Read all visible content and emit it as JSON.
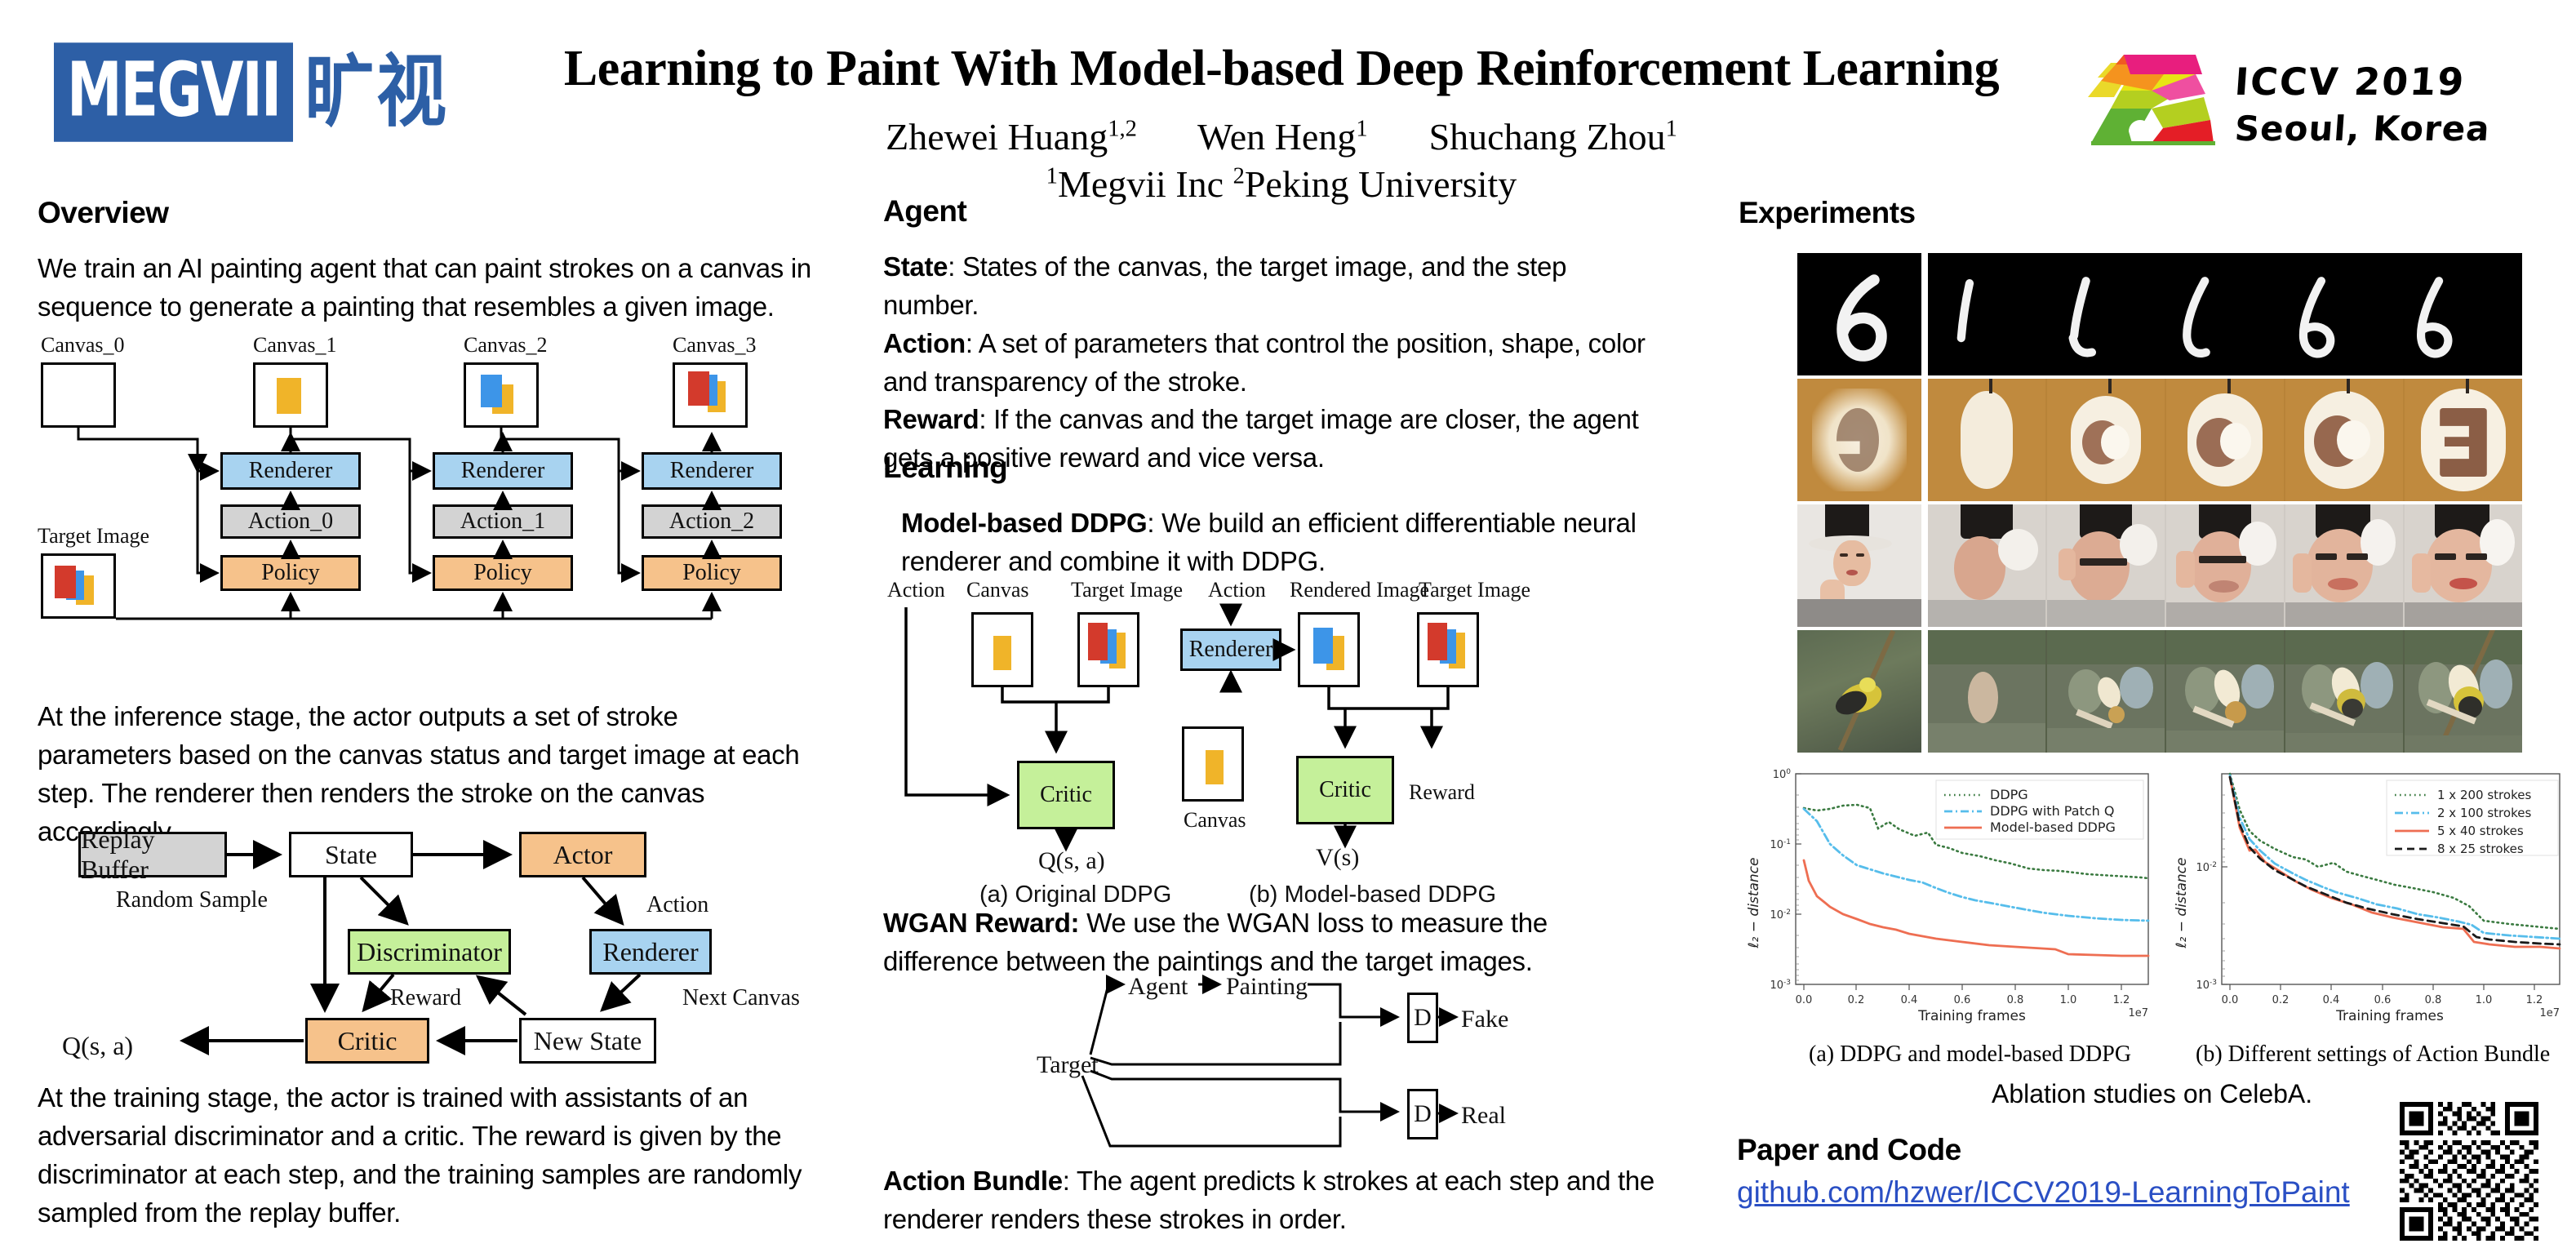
{
  "header": {
    "brand_logo_text": "MEGVII",
    "brand_logo_cn": "旷视",
    "title": "Learning to Paint With Model-based Deep Reinforcement Learning",
    "authors": [
      {
        "name": "Zhewei Huang",
        "sup": "1,2"
      },
      {
        "name": "Wen Heng",
        "sup": "1"
      },
      {
        "name": "Shuchang Zhou",
        "sup": "1"
      }
    ],
    "affiliations": [
      {
        "sup": "1",
        "name": "Megvii Inc"
      },
      {
        "sup": "2",
        "name": "Peking University"
      }
    ],
    "conference_line1": "ICCV 2019",
    "conference_line2": "Seoul, Korea"
  },
  "overview": {
    "heading": "Overview",
    "paragraph1": "We train an AI painting agent that can paint strokes on a canvas in sequence to generate a painting that resembles a given image.",
    "inference_diagram": {
      "canvas_labels": [
        "Canvas_0",
        "Canvas_1",
        "Canvas_2",
        "Canvas_3"
      ],
      "target_label": "Target Image",
      "renderer_label": "Renderer",
      "action_labels": [
        "Action_0",
        "Action_1",
        "Action_2"
      ],
      "policy_label": "Policy"
    },
    "paragraph2": "At the inference stage, the actor outputs a set of stroke parameters based on the canvas status and target image at each step. The renderer then renders the stroke on the canvas accordingly.",
    "training_diagram": {
      "replay_buffer": "Replay Buffer",
      "state": "State",
      "actor": "Actor",
      "discriminator": "Discriminator",
      "renderer": "Renderer",
      "critic": "Critic",
      "new_state": "New State",
      "random_sample": "Random Sample",
      "action": "Action",
      "reward": "Reward",
      "next_canvas": "Next Canvas",
      "q_output": "Q(s, a)"
    },
    "paragraph3": "At the training stage, the actor is trained with assistants of an adversarial discriminator and a critic. The reward is given by the discriminator at each step, and the training samples are randomly sampled from the replay buffer."
  },
  "agent": {
    "heading": "Agent",
    "state_label": "State",
    "state_text": ": States of the canvas, the target image, and the step number.",
    "action_label": "Action",
    "action_text": ": A set of parameters that control the position, shape, color and transparency of the stroke.",
    "reward_label": "Reward",
    "reward_text": ": If the canvas and the target image are closer, the agent gets a positive reward and vice versa."
  },
  "learning": {
    "heading": "Learning",
    "ddpg_label": "Model-based DDPG",
    "ddpg_text": ": We build an efficient differentiable neural renderer and combine it with DDPG.",
    "ddpg_diagram": {
      "left": {
        "action": "Action",
        "canvas": "Canvas",
        "target_image": "Target Image",
        "critic": "Critic",
        "output": "Q(s, a)",
        "caption": "(a) Original DDPG"
      },
      "right": {
        "action": "Action",
        "renderer": "Renderer",
        "rendered_image": "Rendered Image",
        "target_image": "Target Image",
        "canvas": "Canvas",
        "critic": "Critic",
        "reward": "Reward",
        "output": "V(s)",
        "caption": "(b) Model-based DDPG"
      }
    },
    "wgan_label": "WGAN Reward:",
    "wgan_text": " We use the WGAN loss to measure the difference between the paintings and the target images.",
    "wgan_diagram": {
      "agent": "Agent",
      "painting": "Painting",
      "target": "Target",
      "d": "D",
      "fake": "Fake",
      "real": "Real"
    },
    "bundle_label": "Action Bundle",
    "bundle_text": ": The agent predicts k strokes at each step and the renderer renders these strokes in order."
  },
  "experiments": {
    "heading": "Experiments",
    "caption_a": "(a)  DDPG and model-based DDPG",
    "caption_b": "(b) Different settings of Action Bundle",
    "ablation_caption": "Ablation studies on CelebA.",
    "paper_heading": "Paper and Code",
    "link": "github.com/hzwer/ICCV2019-LearningToPaint"
  },
  "colors": {
    "brand_blue": "#2d5fa6",
    "renderer_blue": "#a8d3f0",
    "action_gray": "#d3d3d3",
    "policy_orange": "#f6c28b",
    "critic_green": "#c5f09a",
    "link_blue": "#2a4fc4",
    "series_green": "#3a7a40",
    "series_cyan": "#56bdeb",
    "series_red": "#ee6e52",
    "series_black": "#1a1a1a",
    "stroke_red": "#d33a2c",
    "stroke_blue": "#3d95e8",
    "stroke_yellow": "#f0b429"
  },
  "chart_data": [
    {
      "type": "line",
      "title": "(a)  DDPG and model-based DDPG",
      "xlabel": "Training frames",
      "ylabel": "ℓ₂ − distance",
      "x_exponent": "1e7",
      "xticks": [
        "0.0",
        "0.2",
        "0.4",
        "0.6",
        "0.8",
        "1.0",
        "1.2"
      ],
      "yticks": [
        "10⁰",
        "10⁻¹",
        "10⁻²",
        "10⁻³"
      ],
      "xlim": [
        0.0,
        1.32
      ],
      "ylim": [
        0.001,
        1.0
      ],
      "yscale": "log",
      "grid": false,
      "legend_position": "upper-right",
      "series": [
        {
          "name": "DDPG",
          "style": "dotted",
          "color": "#3a7a40",
          "x": [
            0.0,
            0.05,
            0.1,
            0.15,
            0.2,
            0.25,
            0.28,
            0.32,
            0.36,
            0.42,
            0.47,
            0.5,
            0.55,
            0.6,
            0.65,
            0.7,
            0.75,
            0.8,
            0.85,
            0.9,
            1.0,
            1.1,
            1.2,
            1.32
          ],
          "y": [
            0.29,
            0.27,
            0.28,
            0.3,
            0.305,
            0.29,
            0.195,
            0.235,
            0.19,
            0.16,
            0.175,
            0.125,
            0.115,
            0.097,
            0.09,
            0.08,
            0.072,
            0.063,
            0.06,
            0.058,
            0.053,
            0.05,
            0.048,
            0.046
          ]
        },
        {
          "name": "DDPG with Patch Q",
          "style": "dashdot",
          "color": "#56bdeb",
          "x": [
            0.0,
            0.05,
            0.1,
            0.15,
            0.2,
            0.25,
            0.3,
            0.35,
            0.4,
            0.45,
            0.5,
            0.55,
            0.6,
            0.65,
            0.7,
            0.8,
            0.9,
            1.0,
            1.1,
            1.2,
            1.32
          ],
          "y": [
            0.28,
            0.185,
            0.09,
            0.062,
            0.046,
            0.04,
            0.036,
            0.033,
            0.03,
            0.028,
            0.024,
            0.021,
            0.019,
            0.0175,
            0.0165,
            0.015,
            0.0135,
            0.0125,
            0.0118,
            0.0112,
            0.011
          ]
        },
        {
          "name": "Model-based DDPG",
          "style": "solid",
          "color": "#ee6e52",
          "x": [
            0.0,
            0.02,
            0.05,
            0.08,
            0.1,
            0.15,
            0.2,
            0.25,
            0.3,
            0.35,
            0.4,
            0.5,
            0.6,
            0.7,
            0.8,
            0.9,
            0.95,
            1.0,
            1.1,
            1.2,
            1.32
          ],
          "y": [
            0.058,
            0.03,
            0.018,
            0.0145,
            0.013,
            0.0105,
            0.0092,
            0.008,
            0.0072,
            0.0066,
            0.006,
            0.0053,
            0.0048,
            0.0045,
            0.0043,
            0.0042,
            0.0041,
            0.0036,
            0.0035,
            0.0034,
            0.0034
          ]
        }
      ]
    },
    {
      "type": "line",
      "title": "(b) Different settings of Action Bundle",
      "xlabel": "Training frames",
      "ylabel": "ℓ₂ − distance",
      "x_exponent": "1e7",
      "xticks": [
        "0.0",
        "0.2",
        "0.4",
        "0.6",
        "0.8",
        "1.0",
        "1.2"
      ],
      "yticks": [
        "10⁻²",
        "10⁻³"
      ],
      "xlim": [
        0.0,
        1.32
      ],
      "ylim": [
        0.001,
        0.1
      ],
      "yscale": "log",
      "grid": false,
      "legend_position": "upper-right",
      "series": [
        {
          "name": "1 x 200 strokes",
          "style": "dotted",
          "color": "#3a7a40",
          "x": [
            0.0,
            0.04,
            0.08,
            0.12,
            0.18,
            0.25,
            0.3,
            0.35,
            0.41,
            0.46,
            0.52,
            0.58,
            0.65,
            0.72,
            0.8,
            0.88,
            0.94,
            1.0,
            1.1,
            1.2,
            1.32
          ],
          "y": [
            0.055,
            0.03,
            0.02,
            0.0165,
            0.0145,
            0.013,
            0.0125,
            0.0112,
            0.0118,
            0.0102,
            0.0097,
            0.0092,
            0.0086,
            0.0082,
            0.0078,
            0.0072,
            0.0066,
            0.0055,
            0.0052,
            0.005,
            0.0048
          ]
        },
        {
          "name": "2 x 100 strokes",
          "style": "dashdot",
          "color": "#56bdeb",
          "x": [
            0.0,
            0.04,
            0.08,
            0.12,
            0.18,
            0.25,
            0.3,
            0.36,
            0.42,
            0.5,
            0.58,
            0.66,
            0.74,
            0.82,
            0.9,
            0.95,
            1.0,
            1.1,
            1.2,
            1.32
          ],
          "y": [
            0.052,
            0.026,
            0.017,
            0.0135,
            0.0108,
            0.0092,
            0.0082,
            0.0074,
            0.0068,
            0.0062,
            0.0057,
            0.0054,
            0.005,
            0.0048,
            0.0046,
            0.0044,
            0.0039,
            0.0038,
            0.0037,
            0.0036
          ]
        },
        {
          "name": "5 x 40 strokes",
          "style": "solid",
          "color": "#ee6e52",
          "x": [
            0.0,
            0.04,
            0.08,
            0.1,
            0.14,
            0.2,
            0.26,
            0.32,
            0.4,
            0.48,
            0.56,
            0.64,
            0.74,
            0.84,
            0.92,
            0.96,
            1.02,
            1.12,
            1.22,
            1.32
          ],
          "y": [
            0.05,
            0.021,
            0.014,
            0.0142,
            0.0115,
            0.0096,
            0.008,
            0.007,
            0.0062,
            0.0056,
            0.005,
            0.0047,
            0.0044,
            0.0042,
            0.0041,
            0.0035,
            0.0034,
            0.0033,
            0.0033,
            0.0032
          ]
        },
        {
          "name": "8 x 25 strokes",
          "style": "dashed",
          "color": "#1a1a1a",
          "x": [
            0.0,
            0.04,
            0.08,
            0.12,
            0.18,
            0.24,
            0.3,
            0.38,
            0.46,
            0.54,
            0.64,
            0.74,
            0.84,
            0.92,
            0.97,
            1.02,
            1.12,
            1.22,
            1.32
          ],
          "y": [
            0.05,
            0.022,
            0.0148,
            0.0118,
            0.0098,
            0.0086,
            0.0076,
            0.0067,
            0.006,
            0.0055,
            0.005,
            0.0047,
            0.0045,
            0.0043,
            0.0038,
            0.0037,
            0.0036,
            0.0035,
            0.0035
          ]
        }
      ]
    }
  ]
}
